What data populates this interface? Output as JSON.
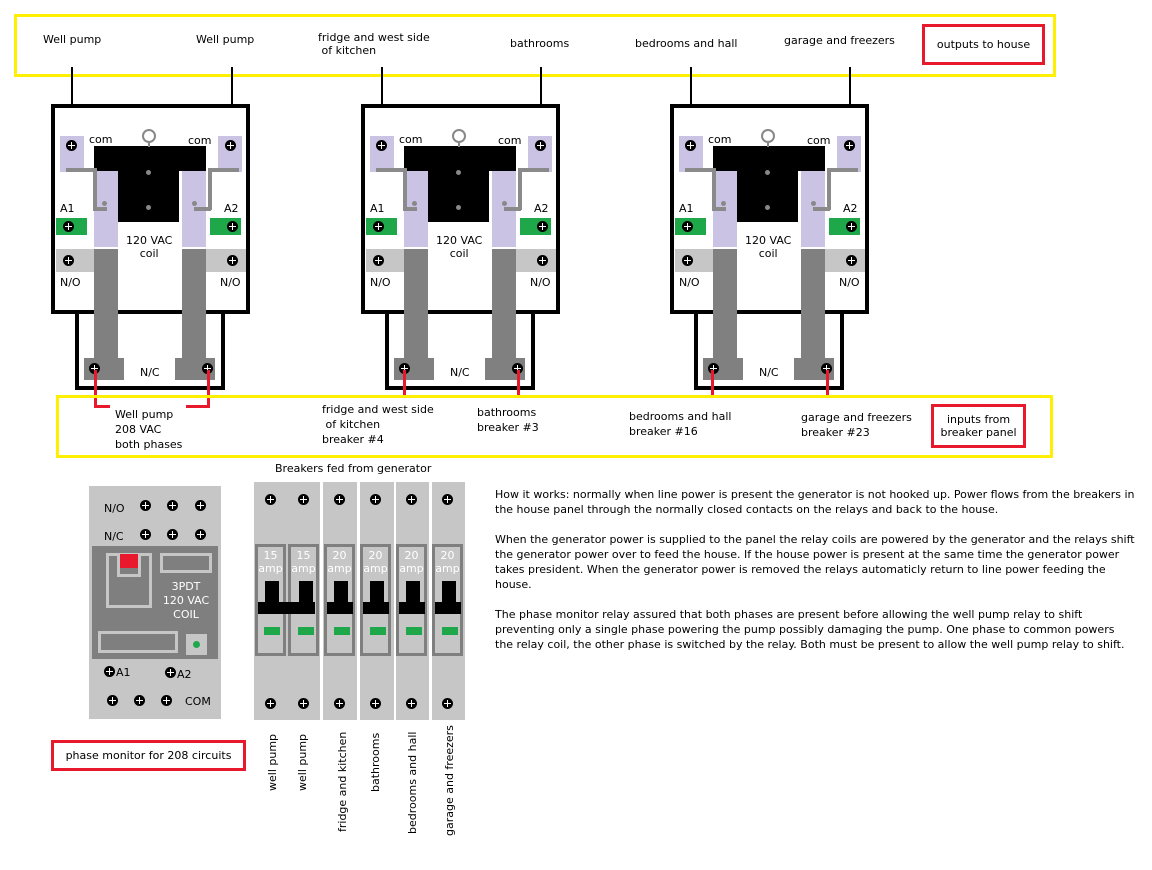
{
  "outputs": {
    "box_label": "outputs to house",
    "labels": [
      "Well pump",
      "Well pump",
      "fridge and west side\n of kitchen",
      "bathrooms",
      "bedrooms and hall",
      "garage and freezers"
    ]
  },
  "relays": [
    {
      "com_left": "com",
      "com_right": "com",
      "a1": "A1",
      "a2": "A2",
      "coil": "120 VAC\ncoil",
      "no_left": "N/O",
      "no_right": "N/O",
      "nc": "N/C"
    },
    {
      "com_left": "com",
      "com_right": "com",
      "a1": "A1",
      "a2": "A2",
      "coil": "120 VAC\ncoil",
      "no_left": "N/O",
      "no_right": "N/O",
      "nc": "N/C"
    },
    {
      "com_left": "com",
      "com_right": "com",
      "a1": "A1",
      "a2": "A2",
      "coil": "120 VAC\ncoil",
      "no_left": "N/O",
      "no_right": "N/O",
      "nc": "N/C"
    }
  ],
  "inputs": {
    "box_label": "inputs from\nbreaker panel",
    "labels": [
      "Well pump\n208 VAC\nboth phases",
      "fridge and west side\n of kitchen\nbreaker #4",
      "bathrooms\nbreaker #3",
      "bedrooms and hall\nbreaker #16",
      "garage and freezers\nbreaker #23"
    ]
  },
  "phase_monitor": {
    "no": "N/O",
    "nc": "N/C",
    "model": "3PDT\n120 VAC\nCOIL",
    "a1": "A1",
    "a2": "A2",
    "com": "COM",
    "caption": "phase monitor for 208 circuits",
    "indicator_color": "#e8192c",
    "led_color": "#1fa84a"
  },
  "breakers": {
    "title": "Breakers fed from generator",
    "items": [
      {
        "rating": "15\namp",
        "label": "well pump"
      },
      {
        "rating": "15\namp",
        "label": "well pump"
      },
      {
        "rating": "20\namp",
        "label": "fridge and kitchen"
      },
      {
        "rating": "20\namp",
        "label": "bathrooms"
      },
      {
        "rating": "20\namp",
        "label": "bedrooms and hall"
      },
      {
        "rating": "20\namp",
        "label": "garage and freezers"
      }
    ]
  },
  "explanation": [
    "How it works: normally when line power is present the generator is not hooked up. Power flows from the breakers in the house panel through the normally closed contacts on the relays and back to the house.",
    "When the generator power is supplied to the panel the relay coils are powered by the generator and the relays shift the generator power over to feed the house. If the house power is present at the same time the generator power takes president. When the generator power is removed the relays automaticly return to line power feeding the house.",
    "The phase monitor relay assured that both phases are present before allowing the well pump relay to shift preventing only a single phase powering the pump possibly damaging the pump. One phase to common powers the relay coil, the other phase is switched by the relay. Both must be present to allow the well pump relay to shift."
  ],
  "colors": {
    "section_border": "#ffef00",
    "callout_border": "#e8192c",
    "input_wire": "#e8192c",
    "com_terminal": "#cbc3e3",
    "coil_terminal": "#1fa84a",
    "contact_bar": "#808080"
  }
}
